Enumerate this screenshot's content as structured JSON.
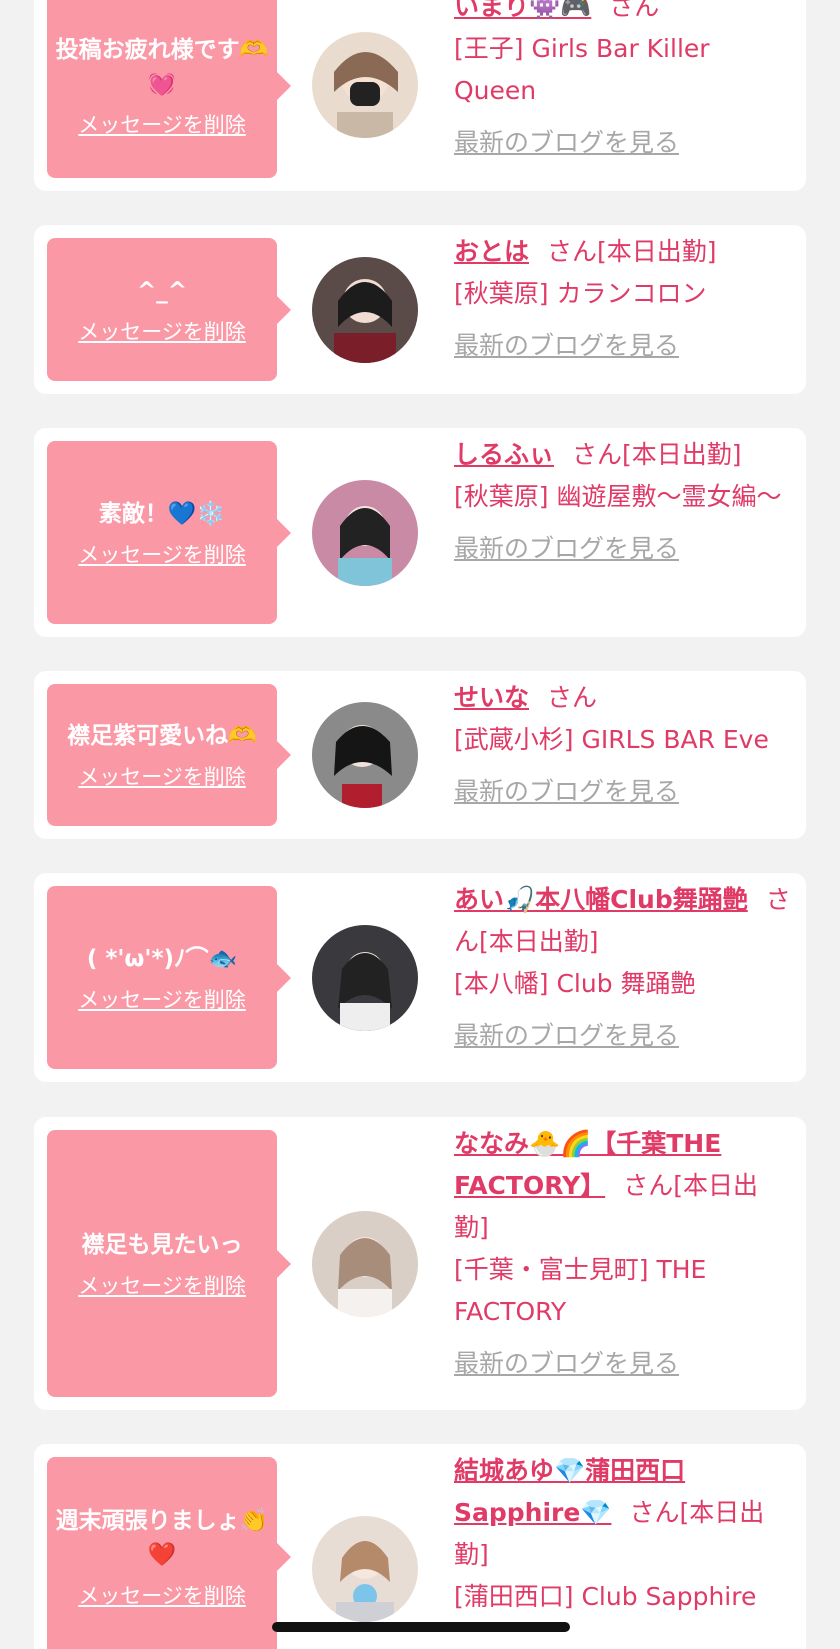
{
  "delete_label": "メッセージを削除",
  "san_label": "さん",
  "blog_label": "最新のブログを見る",
  "accent_color": "#fb98a6",
  "name_color": "#e03a67",
  "link_gray": "#a7a7a7",
  "cards": [
    {
      "message": "投稿お疲れ様です🫶💓",
      "name": "いまり👾🎮",
      "status": "",
      "shop": "[王子] Girls Bar Killer Queen"
    },
    {
      "message": "^_^",
      "name": "おとは",
      "status": "[本日出勤]",
      "shop": "[秋葉原] カランコロン"
    },
    {
      "message": "素敵！💙❄️",
      "name": "しるふぃ",
      "status": "[本日出勤]",
      "shop": "[秋葉原] 幽遊屋敷〜霊女編〜"
    },
    {
      "message": "襟足紫可愛いね🫶",
      "name": "せいな",
      "status": "",
      "shop": "[武蔵小杉] GIRLS BAR Eve"
    },
    {
      "message": "( *'ω'*)ﾉ⌒🐟",
      "name": "あい🎣本八幡Club舞踊艶",
      "status": "[本日出勤]",
      "shop": "[本八幡] Club 舞踊艶"
    },
    {
      "message": "襟足も見たいっ",
      "name": "ななみ🐣🌈【千葉THE FACTORY】",
      "status": "[本日出勤]",
      "shop": "[千葉・富士見町] THE FACTORY"
    },
    {
      "message": "週末頑張りましょ👏❤️",
      "name": "結城あゆ💎蒲田西口Sapphire💎",
      "status": "[本日出勤]",
      "shop": "[蒲田西口] Club Sapphire"
    }
  ]
}
